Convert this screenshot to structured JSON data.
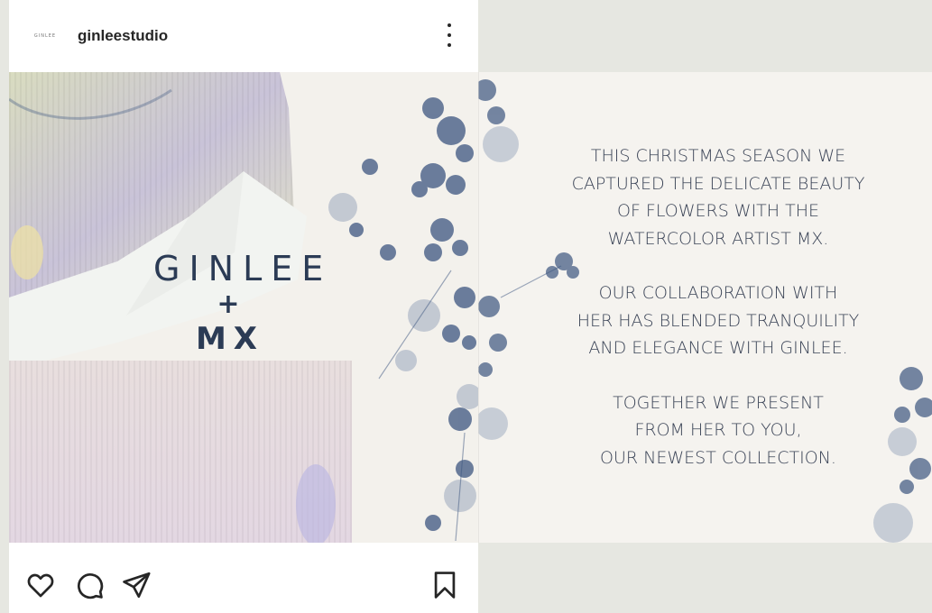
{
  "post": {
    "avatar_text": "GINLEE",
    "username": "ginleestudio"
  },
  "slide_left": {
    "brand_line1": "GINLEE",
    "brand_plus": "+",
    "brand_line2": "MX"
  },
  "slide_right": {
    "paragraphs": [
      [
        "THIS CHRISTMAS SEASON WE",
        "CAPTURED THE DELICATE BEAUTY",
        "OF FLOWERS WITH THE",
        "WATERCOLOR ARTIST MX."
      ],
      [
        "OUR COLLABORATION WITH",
        "HER HAS BLENDED TRANQUILITY",
        "AND ELEGANCE WITH GINLEE."
      ],
      [
        "TOGETHER WE PRESENT",
        "FROM HER TO YOU,",
        "OUR NEWEST COLLECTION."
      ]
    ]
  },
  "icons": {
    "more": "more-vertical-icon",
    "like": "heart-icon",
    "comment": "comment-icon",
    "share": "send-icon",
    "save": "bookmark-icon"
  },
  "colors": {
    "page_bg": "#e6e7e1",
    "brand_text": "#2b3b55",
    "copy_text": "#3a4356",
    "flower_blue": "#3d5680"
  }
}
